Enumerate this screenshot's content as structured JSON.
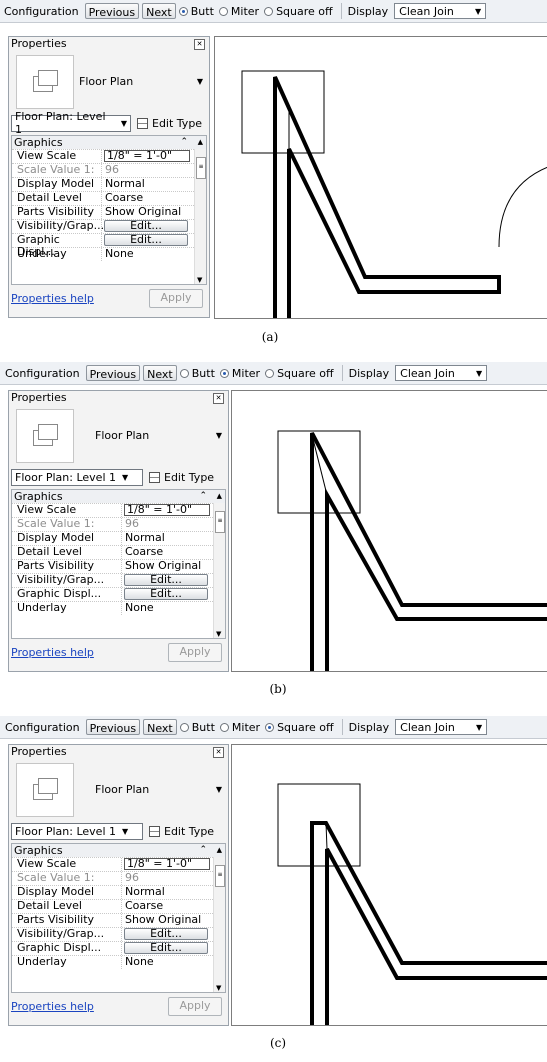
{
  "panels": [
    {
      "caption": "(a)",
      "toolbar": {
        "configuration": "Configuration",
        "previous": "Previous",
        "next": "Next",
        "butt": "Butt",
        "miter": "Miter",
        "square_off": "Square off",
        "display_label": "Display",
        "display_value": "Clean Join",
        "selected": "Butt"
      },
      "properties": {
        "title": "Properties",
        "type_name": "Floor Plan",
        "selector": "Floor Plan: Level 1",
        "edit_type": "Edit Type",
        "group": "Graphics",
        "rows": [
          {
            "key": "View Scale",
            "value": "1/8\" = 1'-0\""
          },
          {
            "key": "Scale Value    1:",
            "value": "96"
          },
          {
            "key": "Display Model",
            "value": "Normal"
          },
          {
            "key": "Detail Level",
            "value": "Coarse"
          },
          {
            "key": "Parts Visibility",
            "value": "Show Original"
          },
          {
            "key": "Visibility/Grap...",
            "value": "Edit..."
          },
          {
            "key": "Graphic Displ...",
            "value": "Edit..."
          },
          {
            "key": "Underlay",
            "value": "None"
          }
        ],
        "help": "Properties help",
        "apply": "Apply"
      }
    },
    {
      "caption": "(b)",
      "toolbar": {
        "configuration": "Configuration",
        "previous": "Previous",
        "next": "Next",
        "butt": "Butt",
        "miter": "Miter",
        "square_off": "Square off",
        "display_label": "Display",
        "display_value": "Clean Join",
        "selected": "Miter"
      },
      "properties": {
        "title": "Properties",
        "type_name": "Floor Plan",
        "selector": "Floor Plan: Level 1",
        "edit_type": "Edit Type",
        "group": "Graphics",
        "rows": [
          {
            "key": "View Scale",
            "value": "1/8\" = 1'-0\""
          },
          {
            "key": "Scale Value    1:",
            "value": "96"
          },
          {
            "key": "Display Model",
            "value": "Normal"
          },
          {
            "key": "Detail Level",
            "value": "Coarse"
          },
          {
            "key": "Parts Visibility",
            "value": "Show Original"
          },
          {
            "key": "Visibility/Grap...",
            "value": "Edit..."
          },
          {
            "key": "Graphic Displ...",
            "value": "Edit..."
          },
          {
            "key": "Underlay",
            "value": "None"
          }
        ],
        "help": "Properties help",
        "apply": "Apply"
      }
    },
    {
      "caption": "(c)",
      "toolbar": {
        "configuration": "Configuration",
        "previous": "Previous",
        "next": "Next",
        "butt": "Butt",
        "miter": "Miter",
        "square_off": "Square off",
        "display_label": "Display",
        "display_value": "Clean Join",
        "selected": "Square off"
      },
      "properties": {
        "title": "Properties",
        "type_name": "Floor Plan",
        "selector": "Floor Plan: Level 1",
        "edit_type": "Edit Type",
        "group": "Graphics",
        "rows": [
          {
            "key": "View Scale",
            "value": "1/8\" = 1'-0\""
          },
          {
            "key": "Scale Value    1:",
            "value": "96"
          },
          {
            "key": "Display Model",
            "value": "Normal"
          },
          {
            "key": "Detail Level",
            "value": "Coarse"
          },
          {
            "key": "Parts Visibility",
            "value": "Show Original"
          },
          {
            "key": "Visibility/Grap...",
            "value": "Edit..."
          },
          {
            "key": "Graphic Displ...",
            "value": "Edit..."
          },
          {
            "key": "Underlay",
            "value": "None"
          }
        ],
        "help": "Properties help",
        "apply": "Apply"
      }
    }
  ]
}
